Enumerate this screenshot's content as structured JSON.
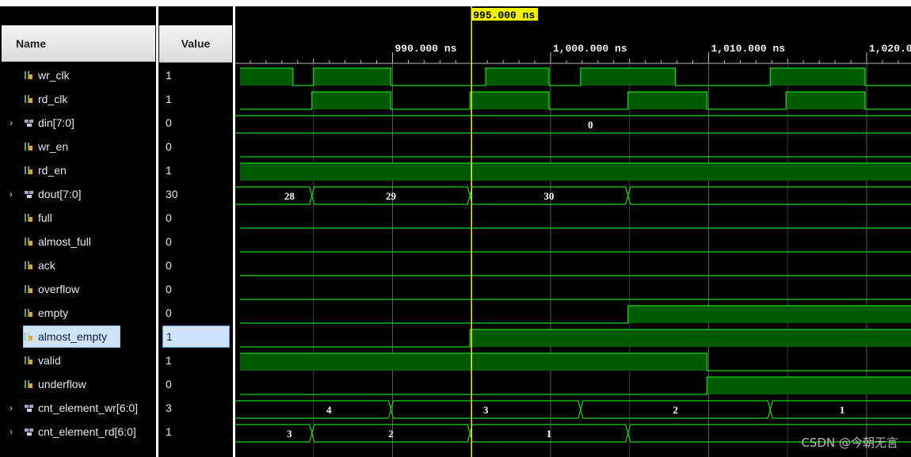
{
  "columns": {
    "name_header": "Name",
    "value_header": "Value"
  },
  "cursor": {
    "label": "995.000 ns",
    "time_ns": 995
  },
  "time_axis": {
    "start_ns": 980.0,
    "ns_per_div": 10,
    "labels": [
      "990.000 ns",
      "1,000.000 ns",
      "1,010.000 ns",
      "1,020.0"
    ],
    "label_times_ns": [
      990,
      1000,
      1010,
      1020
    ]
  },
  "signals": [
    {
      "name": "wr_clk",
      "value": "1",
      "kind": "bit",
      "expandable": false
    },
    {
      "name": "rd_clk",
      "value": "1",
      "kind": "bit",
      "expandable": false
    },
    {
      "name": "din[7:0]",
      "value": "0",
      "kind": "bus",
      "expandable": true
    },
    {
      "name": "wr_en",
      "value": "0",
      "kind": "bit",
      "expandable": false
    },
    {
      "name": "rd_en",
      "value": "1",
      "kind": "bit",
      "expandable": false
    },
    {
      "name": "dout[7:0]",
      "value": "30",
      "kind": "bus",
      "expandable": true
    },
    {
      "name": "full",
      "value": "0",
      "kind": "bit",
      "expandable": false
    },
    {
      "name": "almost_full",
      "value": "0",
      "kind": "bit",
      "expandable": false
    },
    {
      "name": "ack",
      "value": "0",
      "kind": "bit",
      "expandable": false
    },
    {
      "name": "overflow",
      "value": "0",
      "kind": "bit",
      "expandable": false
    },
    {
      "name": "empty",
      "value": "0",
      "kind": "bit",
      "expandable": false
    },
    {
      "name": "almost_empty",
      "value": "1",
      "kind": "bit",
      "expandable": false,
      "selected": true
    },
    {
      "name": "valid",
      "value": "1",
      "kind": "bit",
      "expandable": false
    },
    {
      "name": "underflow",
      "value": "0",
      "kind": "bit",
      "expandable": false
    },
    {
      "name": "cnt_element_wr[6:0]",
      "value": "3",
      "kind": "bus",
      "expandable": true
    },
    {
      "name": "cnt_element_rd[6:0]",
      "value": "1",
      "kind": "bus",
      "expandable": true
    }
  ],
  "waves": {
    "wr_clk": {
      "type": "bit",
      "initial": 1,
      "edges": [
        983.7,
        985.0,
        989.9,
        995.9,
        999.9,
        1001.9,
        1007.9,
        1013.9,
        1019.9
      ]
    },
    "rd_clk": {
      "type": "bit",
      "initial": 0,
      "edges": [
        984.9,
        989.9,
        994.9,
        999.9,
        1004.9,
        1009.9,
        1014.9,
        1019.9
      ]
    },
    "din[7:0]": {
      "type": "bus",
      "segments": [
        {
          "from": 980.0,
          "to": 1023.0,
          "label": "0"
        }
      ]
    },
    "wr_en": {
      "type": "bit",
      "initial": 0,
      "edges": []
    },
    "rd_en": {
      "type": "bit",
      "initial": 1,
      "edges": []
    },
    "dout[7:0]": {
      "type": "bus",
      "segments": [
        {
          "from": 980.0,
          "to": 984.9,
          "label": "28"
        },
        {
          "from": 984.9,
          "to": 994.9,
          "label": "29"
        },
        {
          "from": 994.9,
          "to": 1004.9,
          "label": "30"
        },
        {
          "from": 1004.9,
          "to": 1023.0,
          "label": ""
        }
      ]
    },
    "full": {
      "type": "bit",
      "initial": 0,
      "edges": []
    },
    "almost_full": {
      "type": "bit",
      "initial": 0,
      "edges": []
    },
    "ack": {
      "type": "bit",
      "initial": 0,
      "edges": []
    },
    "overflow": {
      "type": "bit",
      "initial": 0,
      "edges": []
    },
    "empty": {
      "type": "bit",
      "initial": 0,
      "edges": [
        1004.9
      ]
    },
    "almost_empty": {
      "type": "bit",
      "initial": 0,
      "edges": [
        994.9
      ]
    },
    "valid": {
      "type": "bit",
      "initial": 1,
      "edges": [
        1009.9
      ]
    },
    "underflow": {
      "type": "bit",
      "initial": 0,
      "edges": [
        1009.9
      ]
    },
    "cnt_element_wr[6:0]": {
      "type": "bus",
      "segments": [
        {
          "from": 980.0,
          "to": 989.9,
          "label": "4"
        },
        {
          "from": 989.9,
          "to": 1001.9,
          "label": "3"
        },
        {
          "from": 1001.9,
          "to": 1013.9,
          "label": "2"
        },
        {
          "from": 1013.9,
          "to": 1023.0,
          "label": "1"
        }
      ]
    },
    "cnt_element_rd[6:0]": {
      "type": "bus",
      "segments": [
        {
          "from": 980.0,
          "to": 984.9,
          "label": "3"
        },
        {
          "from": 984.9,
          "to": 994.9,
          "label": "2"
        },
        {
          "from": 994.9,
          "to": 1004.9,
          "label": "1"
        },
        {
          "from": 1004.9,
          "to": 1023.0,
          "label": ""
        }
      ]
    }
  },
  "colors": {
    "background": "#000000",
    "wave_line": "#1fd21f",
    "wave_fill": "#005a00",
    "grid": "#5a5a5a",
    "cursor": "#f2f200",
    "cursor_label_bg": "#f2f200",
    "text": "#ffffff"
  },
  "watermark": "CSDN @今朝无言"
}
